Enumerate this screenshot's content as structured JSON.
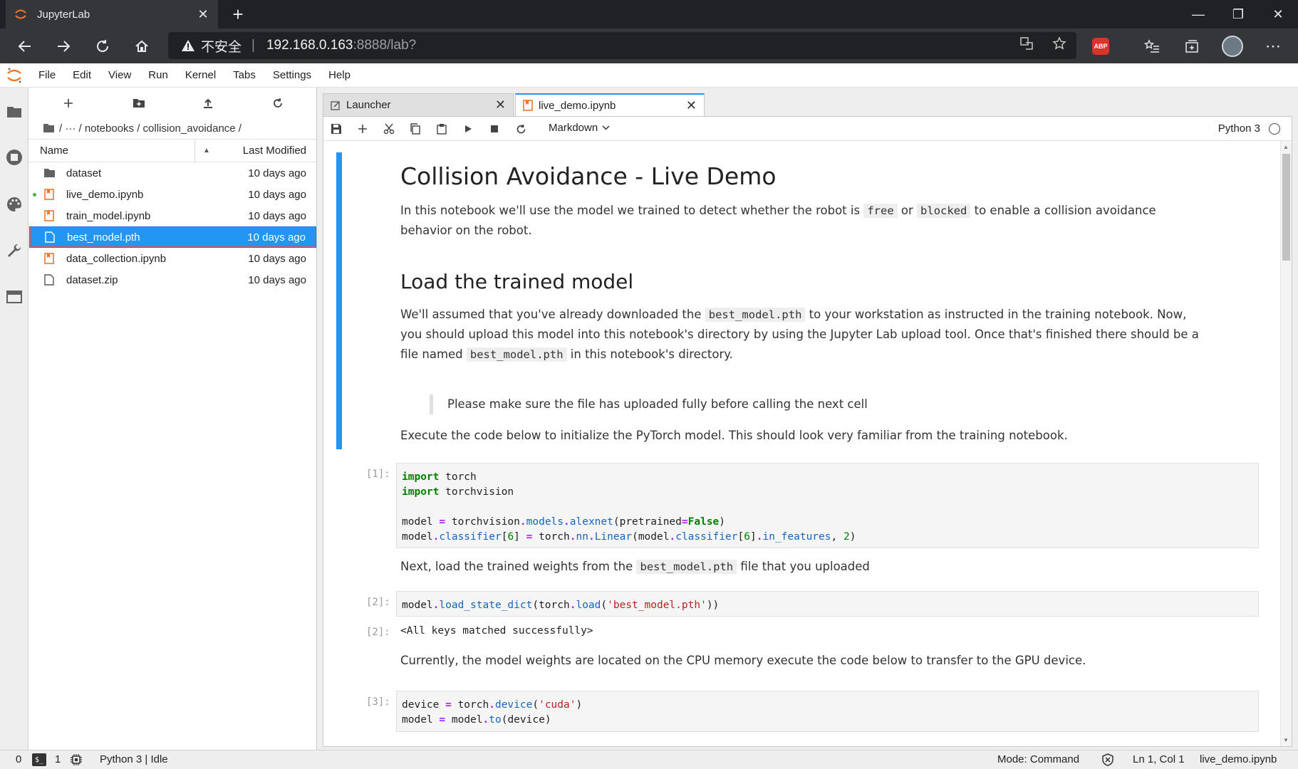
{
  "browser": {
    "tab_title": "JupyterLab",
    "tab_close": "✕",
    "new_tab": "+",
    "minimize": "—",
    "restore": "❐",
    "close": "✕",
    "security_label": "不安全",
    "separator": "|",
    "url_host": "192.168.0.163",
    "url_rest": ":8888/lab?",
    "extension_abp": "ABP",
    "more_menu": "⋯"
  },
  "menubar": {
    "items": [
      "File",
      "Edit",
      "View",
      "Run",
      "Kernel",
      "Tabs",
      "Settings",
      "Help"
    ]
  },
  "filebrowser": {
    "breadcrumb": "/ ··· / notebooks / collision_avoidance /",
    "header_name": "Name",
    "header_sort": "▲",
    "header_modified": "Last Modified",
    "files": [
      {
        "name": "dataset",
        "modified": "10 days ago",
        "icon": "folder-icon",
        "running": false,
        "selected": false
      },
      {
        "name": "live_demo.ipynb",
        "modified": "10 days ago",
        "icon": "notebook-icon",
        "running": true,
        "selected": false
      },
      {
        "name": "train_model.ipynb",
        "modified": "10 days ago",
        "icon": "notebook-icon",
        "running": false,
        "selected": false
      },
      {
        "name": "best_model.pth",
        "modified": "10 days ago",
        "icon": "file-icon",
        "running": false,
        "selected": true
      },
      {
        "name": "data_collection.ipynb",
        "modified": "10 days ago",
        "icon": "notebook-icon",
        "running": false,
        "selected": false
      },
      {
        "name": "dataset.zip",
        "modified": "10 days ago",
        "icon": "file-icon",
        "running": false,
        "selected": false
      }
    ]
  },
  "doc_tabs": [
    {
      "label": "Launcher",
      "close": "✕"
    },
    {
      "label": "live_demo.ipynb",
      "close": "✕"
    }
  ],
  "notebook_toolbar": {
    "cell_type": "Markdown",
    "kernel": "Python 3"
  },
  "notebook": {
    "h1": "Collision Avoidance - Live Demo",
    "p1_a": "In this notebook we'll use the model we trained to detect whether the robot is ",
    "p1_code1": "free",
    "p1_b": " or ",
    "p1_code2": "blocked",
    "p1_c": " to enable a collision avoidance behavior on the robot.",
    "h2": "Load the trained model",
    "p2_a": "We'll assumed that you've already downloaded the ",
    "p2_code1": "best_model.pth",
    "p2_b": " to your workstation as instructed in the training notebook. Now, you should upload this model into this notebook's directory by using the Jupyter Lab upload tool. Once that's finished there should be a file named ",
    "p2_code2": "best_model.pth",
    "p2_c": " in this notebook's directory.",
    "quote": "Please make sure the file has uploaded fully before calling the next cell",
    "p3": "Execute the code below to initialize the PyTorch model. This should look very familiar from the training notebook.",
    "prompt1": "[1]:",
    "p4_a": "Next, load the trained weights from the ",
    "p4_code": "best_model.pth",
    "p4_b": " file that you uploaded",
    "prompt2": "[2]:",
    "out_prompt2": "[2]:",
    "output2": "<All keys matched successfully>",
    "p5": "Currently, the model weights are located on the CPU memory execute the code below to transfer to the GPU device.",
    "prompt3": "[3]:"
  },
  "statusbar": {
    "terminals": "0",
    "kernels": "1",
    "terminal_icon_text": "$_",
    "kernel_status": "Python 3 | Idle",
    "mode": "Mode: Command",
    "position": "Ln 1, Col 1",
    "file": "live_demo.ipynb"
  }
}
